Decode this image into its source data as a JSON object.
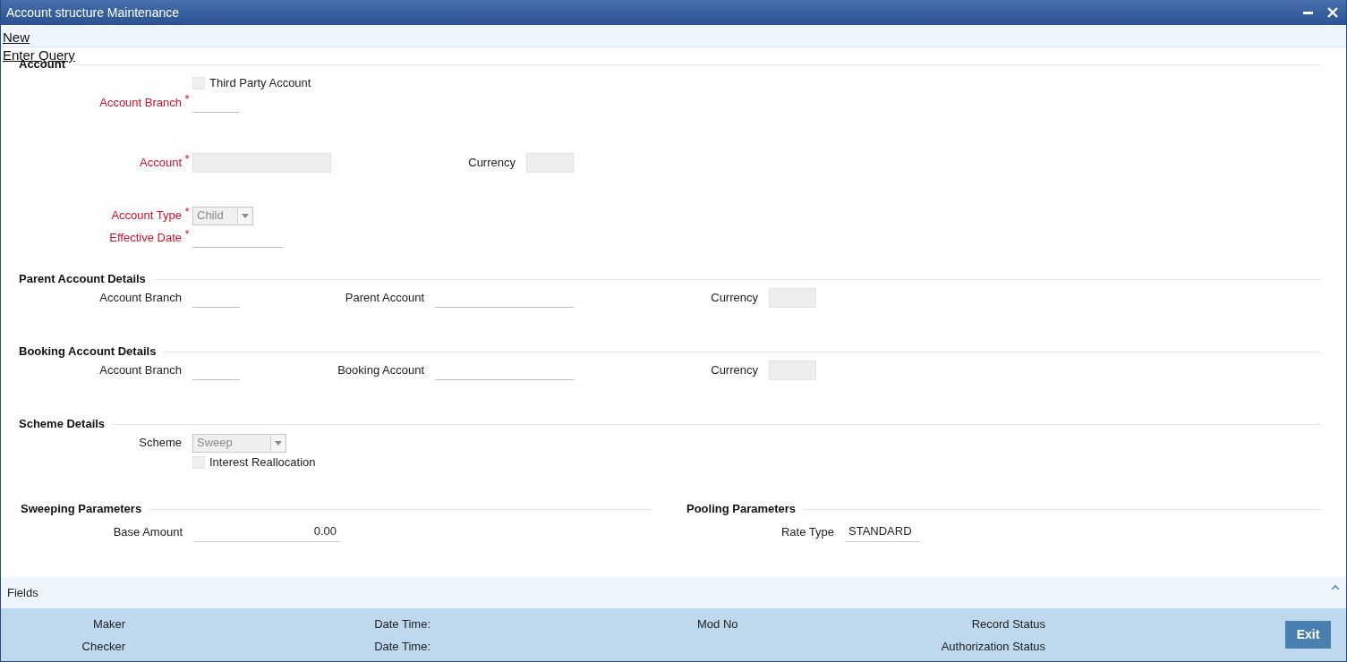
{
  "window": {
    "title": "Account structure Maintenance"
  },
  "actions": [
    "New",
    "Enter Query"
  ],
  "sections": [
    {
      "title": "Account",
      "rows": [
        [
          {
            "kind": "checkbox",
            "label": "Third Party Account",
            "checked": false
          }
        ],
        [
          {
            "kind": "code",
            "label": "Account Branch",
            "required": true,
            "marker": "*",
            "readonly": false
          }
        ],
        [
          {
            "kind": "account",
            "label": "Account",
            "required": true,
            "marker": "*",
            "readonly": true
          },
          {
            "kind": "code",
            "label": "Currency",
            "required": false,
            "readonly": true
          }
        ],
        [
          {
            "kind": "select",
            "label": "Account Type",
            "required": true,
            "marker": "*",
            "value": "Child",
            "disabled": true
          }
        ],
        [
          {
            "kind": "date",
            "label": "Effective Date",
            "required": true,
            "marker": "*",
            "readonly": false
          }
        ]
      ]
    },
    {
      "title": "Parent Account Details",
      "rows": [
        [
          {
            "kind": "code",
            "label": "Account Branch",
            "required": false,
            "readonly": false
          },
          {
            "kind": "account",
            "label": "Parent Account",
            "required": false,
            "readonly": false
          },
          {
            "kind": "code",
            "label": "Currency",
            "required": false,
            "readonly": true
          }
        ]
      ]
    },
    {
      "title": "Booking Account Details",
      "rows": [
        [
          {
            "kind": "code",
            "label": "Account Branch",
            "required": false,
            "readonly": false
          },
          {
            "kind": "account",
            "label": "Booking Account",
            "required": false,
            "readonly": false
          },
          {
            "kind": "code",
            "label": "Currency",
            "required": false,
            "readonly": true
          }
        ]
      ]
    },
    {
      "title": "Scheme Details",
      "rows": [
        [
          {
            "kind": "select",
            "label": "Scheme",
            "required": false,
            "value": "Sweep",
            "disabled": true
          }
        ],
        [
          {
            "kind": "checkbox",
            "label": "Interest Reallocation",
            "checked": false
          }
        ]
      ]
    }
  ],
  "parameters": [
    {
      "title": "Sweeping Parameters",
      "rows": [
        {
          "kind": "amount",
          "label": "Base Amount",
          "value": "0.00"
        }
      ]
    },
    {
      "title": "Pooling Parameters",
      "rows": [
        {
          "kind": "text",
          "label": "Rate Type",
          "value": "STANDARD"
        }
      ]
    }
  ],
  "fields_bar": {
    "label": "Fields"
  },
  "footer": {
    "columns": [
      [
        "Maker",
        "Checker"
      ],
      [
        "Date Time:",
        "Date Time:"
      ],
      [
        "Mod No"
      ],
      [
        "Record Status",
        "Authorization Status"
      ]
    ],
    "button": "Exit"
  }
}
